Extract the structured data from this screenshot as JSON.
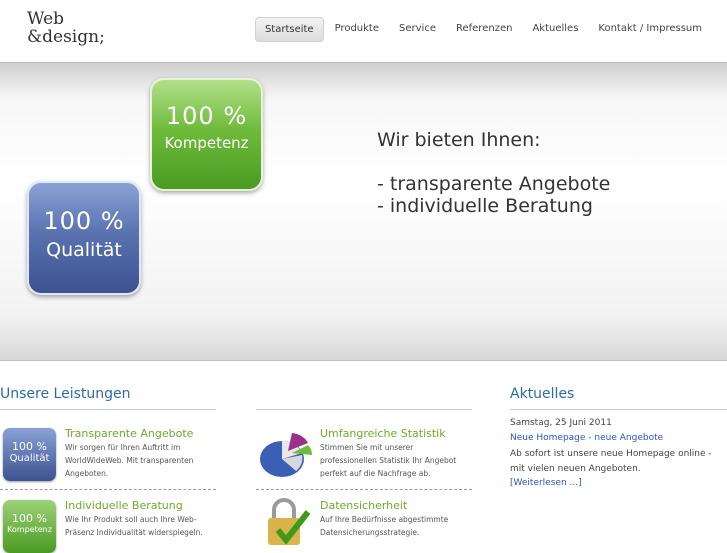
{
  "header": {
    "logo_line1": "Web",
    "logo_line2": "&design;",
    "nav": [
      {
        "label": "Startseite",
        "active": true
      },
      {
        "label": "Produkte"
      },
      {
        "label": "Service"
      },
      {
        "label": "Referenzen"
      },
      {
        "label": "Aktuelles"
      },
      {
        "label": "Kontakt / Impressum"
      }
    ]
  },
  "banner": {
    "tile_green": {
      "pct": "100 %",
      "word": "Kompetenz"
    },
    "tile_blue": {
      "pct": "100 %",
      "word": "Qualität"
    },
    "tagline_heading": "Wir bieten Ihnen:",
    "tagline_items": [
      "- transparente Angebote",
      "- individuelle Beratung"
    ]
  },
  "leistungen": {
    "title": "Unsere Leistungen",
    "items": [
      {
        "title": "Transparente Angebote",
        "text": "Wir sorgen für Ihren Auftritt im WorldWideWeb. Mit transparenten Angeboten.",
        "icon": {
          "pct": "100 %",
          "word": "Qualität"
        }
      },
      {
        "title": "Individuelle Beratung",
        "text": "Wie Ihr Produkt soll auch Ihre Web-Präsenz Individualität widerspiegeln.",
        "icon": {
          "pct": "100 %",
          "word": "Kompetenz"
        }
      },
      {
        "title": "Umfangreiche Statistik",
        "text": "Stimmen Sie mit unserer professionellen Statistik Ihr Angebot perfekt auf die Nachfrage ab.",
        "icon": "pie-chart-icon"
      },
      {
        "title": "Datensicherheit",
        "text": "Auf Ihre Bedürfnisse abgestimmte Datensicherungsstrategie.",
        "icon": "padlock-check-icon"
      }
    ]
  },
  "aktuelles": {
    "title": "Aktuelles",
    "date": "Samstag, 25 Juni 2011",
    "headline": "Neue Homepage - neue Angebote",
    "text": "Ab sofort ist unsere neue Homepage online - mit vielen neuen Angeboten.",
    "more": "[Weiterlesen ...]"
  },
  "colors": {
    "accent_blue": "#2e6aa8",
    "accent_green": "#6eaa2e",
    "link": "#2a55c4"
  }
}
